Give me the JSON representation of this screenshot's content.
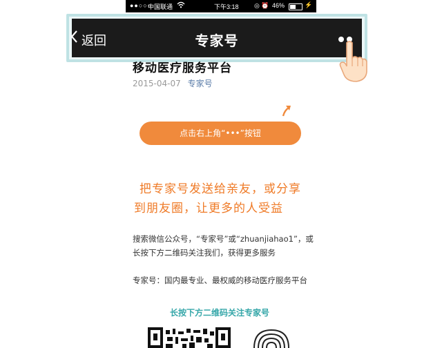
{
  "status_bar": {
    "signal": "●●○○○",
    "carrier": "中国联通",
    "wifi_icon": "wifi-icon",
    "time": "下午3:18",
    "battery": "46%"
  },
  "nav": {
    "back_label": "返回",
    "title": "专家号",
    "more_icon": "more-dots-icon"
  },
  "article": {
    "title": "移动医疗服务平台",
    "date": "2015-04-07",
    "author": "专家号"
  },
  "guide": {
    "button_label": "点击右上角“•••”按钮",
    "headline_line1": "把专家号发送给亲友，或分享",
    "headline_line2": "到朋友圈，让更多的人受益",
    "para1": "搜索微信公众号，“专家号”或“zhuanjiahao1”，或长按下方二维码关注我们，获得更多服务",
    "para2": "专家号：国内最专业、最权威的移动医疗服务平台",
    "qr_caption": "长按下方二维码关注专家号"
  },
  "colors": {
    "accent_orange": "#f08a3c",
    "headline_orange": "#ef7a26",
    "teal": "#36a7a9",
    "navbar": "#1b1b1b"
  }
}
